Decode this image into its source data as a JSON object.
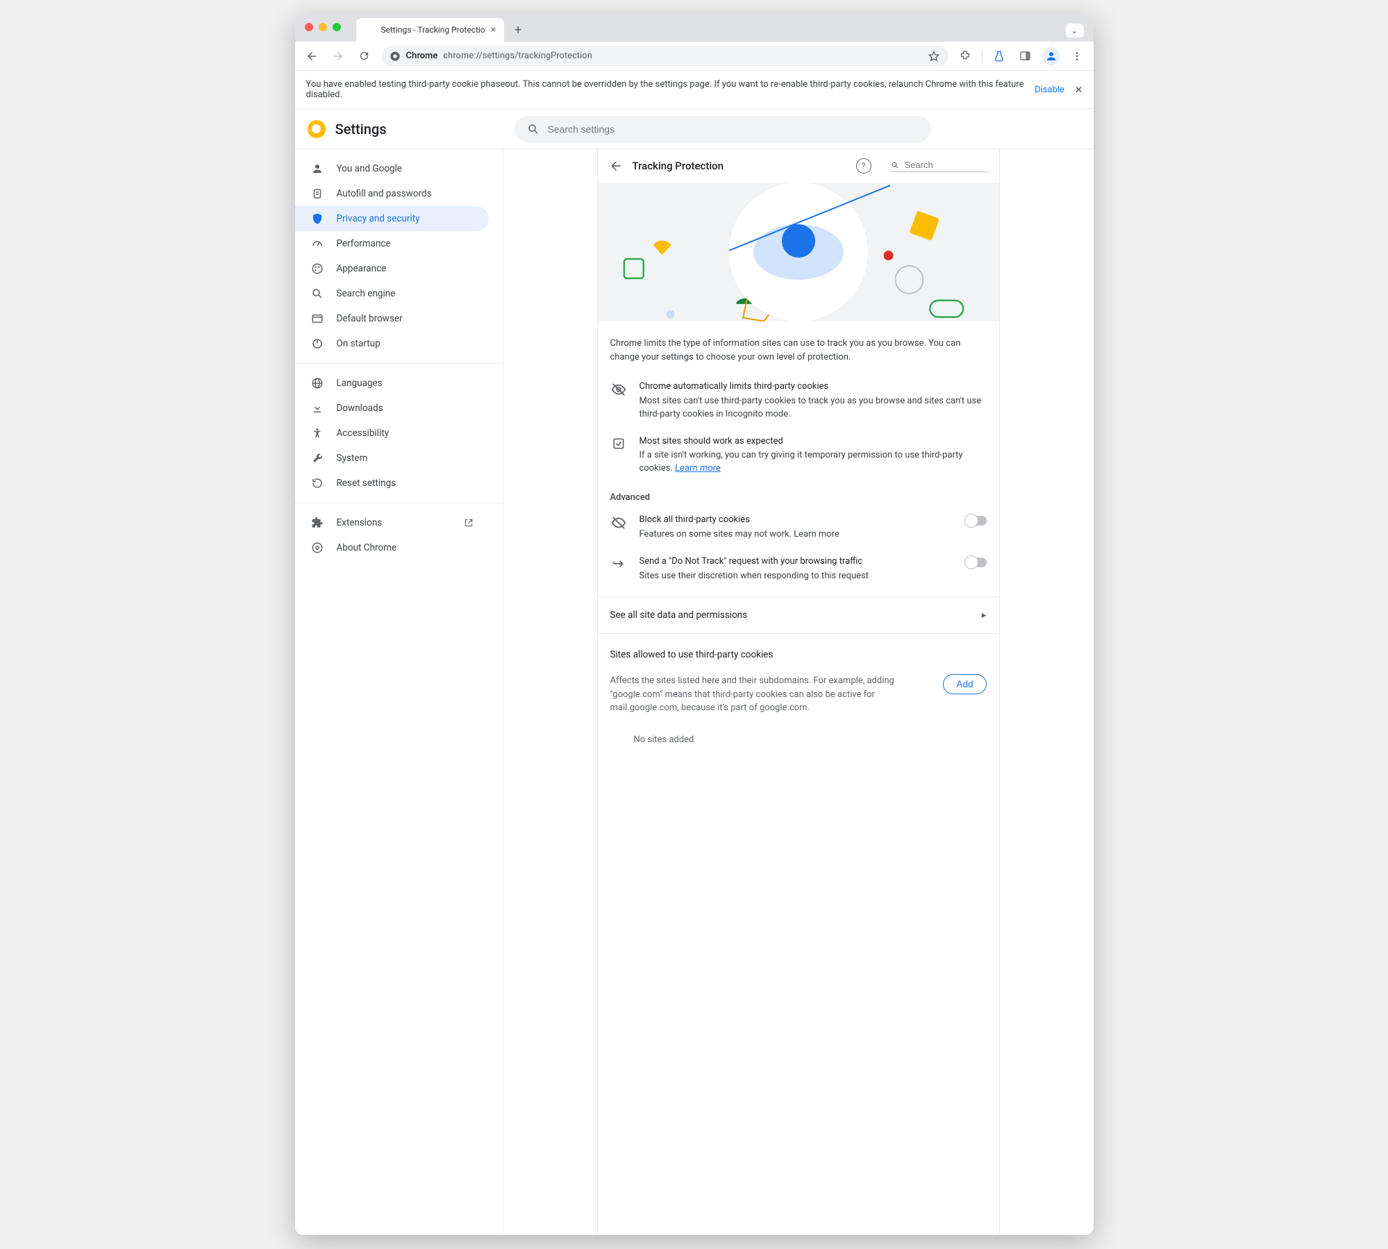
{
  "window": {
    "tab_title": "Settings - Tracking Protectio",
    "url_label": "Chrome",
    "url_path": "chrome://settings/trackingProtection"
  },
  "banner": {
    "text": "You have enabled testing third-party cookie phaseout. This cannot be overridden by the settings page. If you want to re-enable third-party cookies, relaunch Chrome with this feature disabled.",
    "disable": "Disable"
  },
  "header": {
    "title": "Settings",
    "search_placeholder": "Search settings"
  },
  "sidebar": {
    "items": [
      {
        "label": "You and Google"
      },
      {
        "label": "Autofill and passwords"
      },
      {
        "label": "Privacy and security"
      },
      {
        "label": "Performance"
      },
      {
        "label": "Appearance"
      },
      {
        "label": "Search engine"
      },
      {
        "label": "Default browser"
      },
      {
        "label": "On startup"
      }
    ],
    "items2": [
      {
        "label": "Languages"
      },
      {
        "label": "Downloads"
      },
      {
        "label": "Accessibility"
      },
      {
        "label": "System"
      },
      {
        "label": "Reset settings"
      }
    ],
    "items3": [
      {
        "label": "Extensions"
      },
      {
        "label": "About Chrome"
      }
    ]
  },
  "panel": {
    "title": "Tracking Protection",
    "search_placeholder": "Search",
    "description": "Chrome limits the type of information sites can use to track you as you browse. You can change your settings to choose your own level of protection.",
    "auto": {
      "title": "Chrome automatically limits third-party cookies",
      "text": "Most sites can't use third-party cookies to track you as you browse and sites can't use third-party cookies in Incognito mode."
    },
    "expected": {
      "title": "Most sites should work as expected",
      "text": "If a site isn't working, you can try giving it temporary permission to use third-party cookies.",
      "learn": "Learn more"
    },
    "advanced": "Advanced",
    "block": {
      "title": "Block all third-party cookies",
      "text": "Features on some sites may not work. ",
      "learn": "Learn more"
    },
    "dnt": {
      "title": "Send a \"Do Not Track\" request with your browsing traffic",
      "text": "Sites use their discretion when responding to this request"
    },
    "seeall": "See all site data and permissions",
    "allowed_title": "Sites allowed to use third-party cookies",
    "allowed_text": "Affects the sites listed here and their subdomains. For example, adding \"google.com\" means that third-party cookies can also be active for mail.google.com, because it's part of google.com.",
    "add": "Add",
    "nosites": "No sites added"
  }
}
